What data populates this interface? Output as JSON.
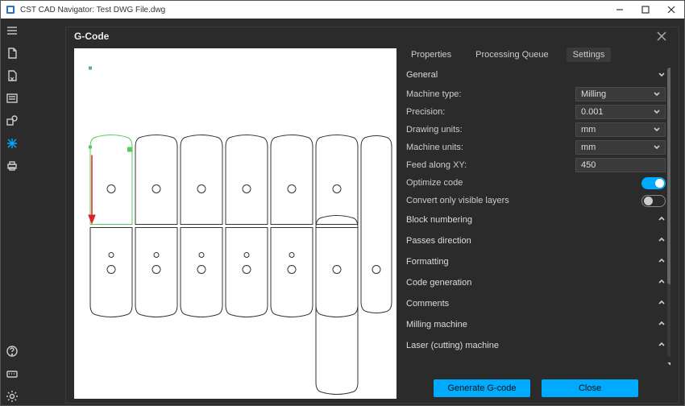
{
  "window": {
    "title": "CST CAD Navigator: Test DWG File.dwg"
  },
  "dialog": {
    "title": "G-Code",
    "tabs": {
      "properties": "Properties",
      "queue": "Processing Queue",
      "settings": "Settings",
      "active": "settings"
    },
    "buttons": {
      "generate": "Generate G-code",
      "close": "Close"
    }
  },
  "settings": {
    "general": {
      "label": "General",
      "machine_type": {
        "label": "Machine type:",
        "value": "Milling"
      },
      "precision": {
        "label": "Precision:",
        "value": "0.001"
      },
      "drawing_units": {
        "label": "Drawing units:",
        "value": "mm"
      },
      "machine_units": {
        "label": "Machine units:",
        "value": "mm"
      },
      "feed_xy": {
        "label": "Feed along XY:",
        "value": "450"
      },
      "optimize": {
        "label": "Optimize code",
        "value": true
      },
      "visible_layers": {
        "label": "Convert only visible layers",
        "value": false
      }
    },
    "sections": {
      "block_numbering": "Block numbering",
      "passes_direction": "Passes direction",
      "formatting": "Formatting",
      "code_generation": "Code generation",
      "comments": "Comments",
      "milling_machine": "Milling machine",
      "laser_machine": "Laser (cutting) machine"
    }
  }
}
